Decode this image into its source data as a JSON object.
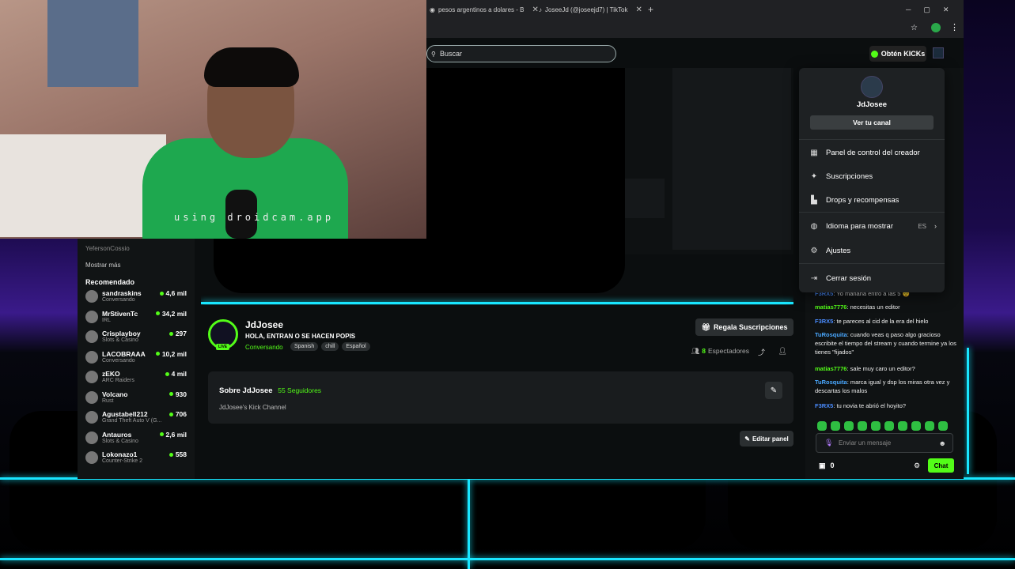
{
  "browser": {
    "tabs": [
      {
        "label": "pesos argentinos a dolares - B"
      },
      {
        "label": "JoseeJd (@joseejd7) | TikTok"
      }
    ],
    "new_tab": "+"
  },
  "header": {
    "search_placeholder": "Buscar",
    "get_kicks": "Obtén KICKs"
  },
  "webcam": {
    "caption": "using droidcam.app"
  },
  "sidebar": {
    "followed_top": "YefersonCossio",
    "show_more": "Mostrar más",
    "recommended_title": "Recomendado",
    "items": [
      {
        "name": "sandraskins",
        "category": "Conversando",
        "viewers": "4,6 mil"
      },
      {
        "name": "MrStivenTc",
        "category": "IRL",
        "viewers": "34,2 mil"
      },
      {
        "name": "Crisplayboy",
        "category": "Slots & Casino",
        "viewers": "297"
      },
      {
        "name": "LACOBRAAA",
        "category": "Conversando",
        "viewers": "10,2 mil"
      },
      {
        "name": "zEKO",
        "category": "ARC Raiders",
        "viewers": "4 mil"
      },
      {
        "name": "Volcano",
        "category": "Rust",
        "viewers": "930"
      },
      {
        "name": "Agustabell212",
        "category": "Grand Theft Auto V (G...",
        "viewers": "706"
      },
      {
        "name": "Antauros",
        "category": "Slots & Casino",
        "viewers": "2,6 mil"
      },
      {
        "name": "Lokonazo1",
        "category": "Counter-Strike 2",
        "viewers": "558"
      }
    ]
  },
  "channel": {
    "live_badge": "LIVE",
    "name": "JdJosee",
    "title": "HOLA, ENTRAN O SE HACEN POPIS",
    "category": "Conversando",
    "tags": [
      "Spanish",
      "chill",
      "Español"
    ],
    "gift_subs": "Regala Suscripciones",
    "viewer_count": "8",
    "viewer_label": "Espectadores",
    "about_title": "Sobre JdJosee",
    "followers": "55 Seguidores",
    "description": "JdJosee's Kick Channel",
    "edit_panel": "Editar panel"
  },
  "chat": {
    "messages": [
      {
        "user": "F3RX5",
        "text": ": Yo mañana entro a las 5 😴",
        "color": "#4a8cff"
      },
      {
        "user": "matias7776",
        "text": ": necesitas un editor",
        "color": "#53fc18"
      },
      {
        "user": "F3RX5",
        "text": ": te pareces al cid de la era del hielo",
        "color": "#4a8cff"
      },
      {
        "user": "TuRosquita",
        "text": ": cuando veas q paso algo gracioso escribite el tiempo del stream y cuando termine ya los tienes \"fijados\"",
        "color": "#4aa8ff"
      },
      {
        "user": "matias7776",
        "text": ": sale muy caro un editor?",
        "color": "#53fc18"
      },
      {
        "user": "TuRosquita",
        "text": ": marca igual y dsp los miras otra vez y descartas los malos",
        "color": "#4aa8ff"
      },
      {
        "user": "F3RX5",
        "text": ": tu novia te abrió el hoyito?",
        "color": "#4a8cff"
      }
    ],
    "input_placeholder": "Enviar un mensaje",
    "kicks_count": "0",
    "send_label": "Chat"
  },
  "user_menu": {
    "username": "JdJosee",
    "view_channel": "Ver tu canal",
    "items": [
      {
        "label": "Panel de control del creador",
        "icon": "dashboard-icon"
      },
      {
        "label": "Suscripciones",
        "icon": "sparkle-icon"
      },
      {
        "label": "Drops y recompensas",
        "icon": "drops-icon"
      },
      {
        "label": "Idioma para mostrar",
        "icon": "globe-icon",
        "value": "ES"
      },
      {
        "label": "Ajustes",
        "icon": "gear-icon"
      },
      {
        "label": "Cerrar sesión",
        "icon": "logout-icon"
      }
    ]
  },
  "colors": {
    "accent": "#53fc18",
    "neon": "#19e6ff"
  }
}
